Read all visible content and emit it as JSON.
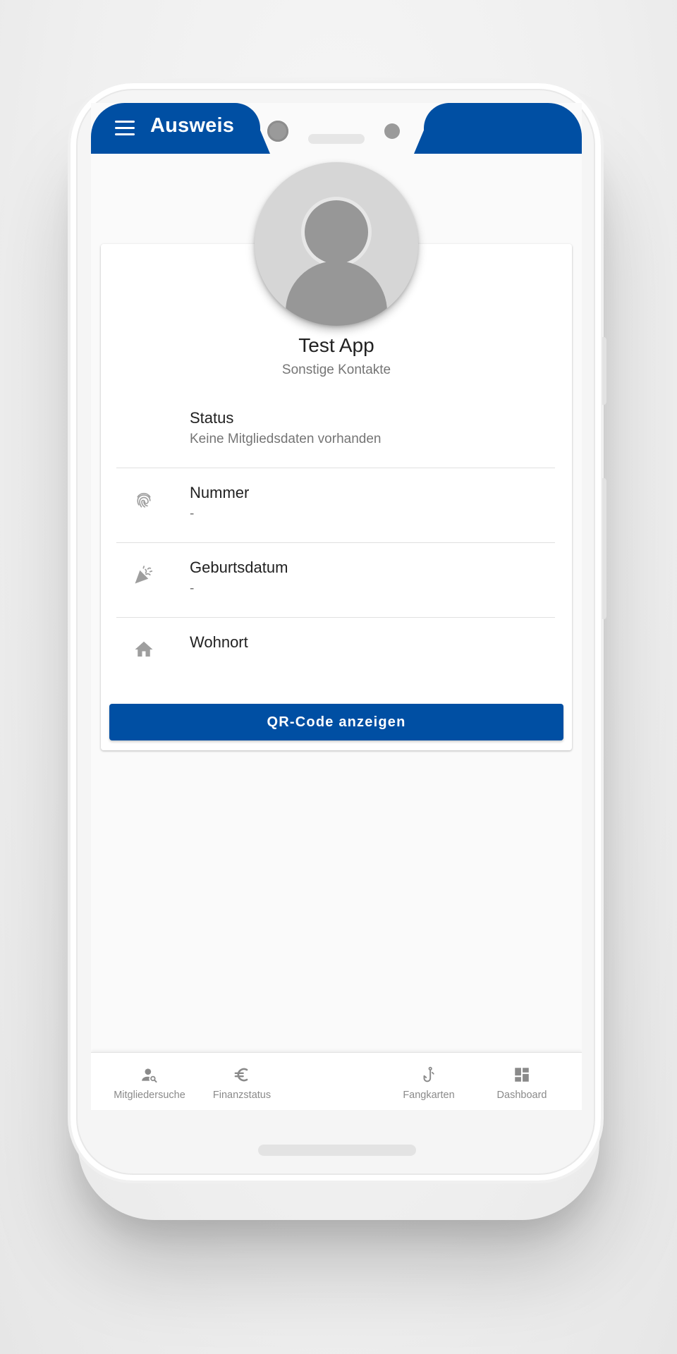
{
  "appbar": {
    "title": "Ausweis",
    "menu_icon": "menu-icon",
    "color": "#004fa3"
  },
  "profile": {
    "name": "Test App",
    "subtitle": "Sonstige Kontakte",
    "avatar_icon": "person-placeholder-icon"
  },
  "details": [
    {
      "label": "Status",
      "value": "Keine Mitgliedsdaten vorhanden",
      "icon": "none"
    },
    {
      "label": "Nummer",
      "value": "-",
      "icon": "fingerprint-icon"
    },
    {
      "label": "Geburtsdatum",
      "value": "-",
      "icon": "celebration-icon"
    },
    {
      "label": "Wohnort",
      "value": "",
      "icon": "home-icon"
    }
  ],
  "actions": {
    "qr_button_label": "QR-Code anzeigen"
  },
  "bottom_nav": {
    "items": [
      {
        "label": "Mitgliedersuche",
        "icon": "person-search-icon"
      },
      {
        "label": "Finanzstatus",
        "icon": "euro-icon"
      },
      {
        "label": "Fangkarten",
        "icon": "fishing-hook-icon"
      },
      {
        "label": "Dashboard",
        "icon": "dashboard-icon"
      }
    ]
  },
  "colors": {
    "primary": "#004fa3",
    "icon_gray": "#9e9e9e",
    "text_secondary": "#757575"
  }
}
